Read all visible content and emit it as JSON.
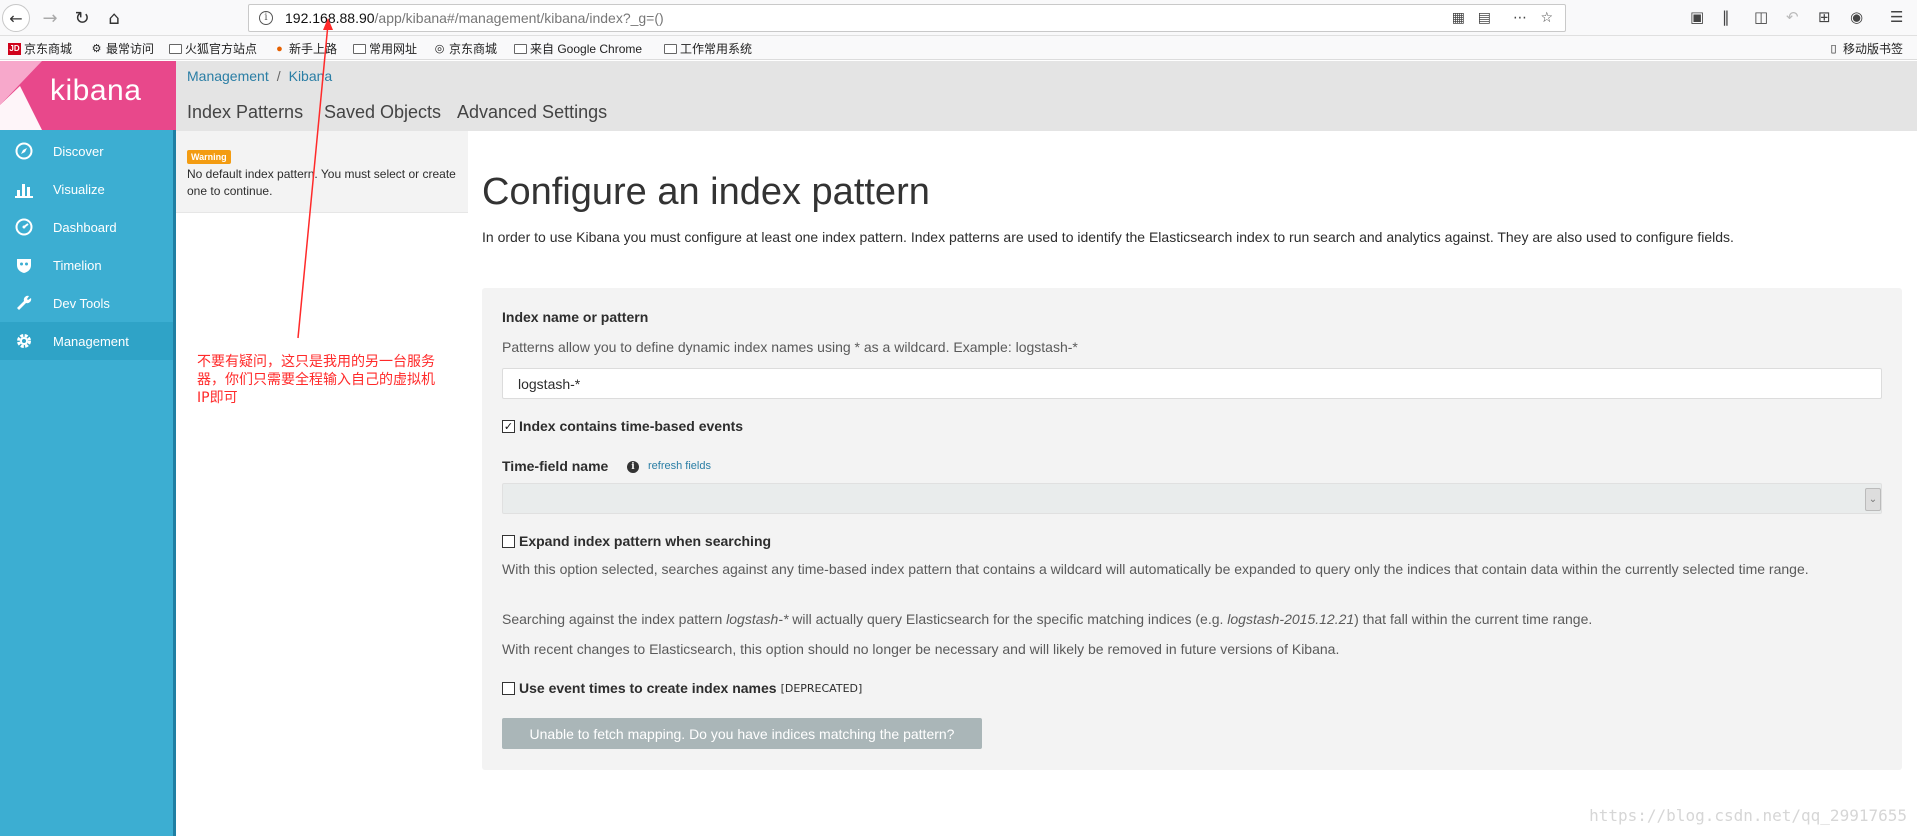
{
  "browser": {
    "url_host": "192.168.88.90",
    "url_path": "/app/kibana#/management/kibana/index?_g=()",
    "bookmarks": [
      "京东商城",
      "最常访问",
      "火狐官方站点",
      "新手上路",
      "常用网址",
      "京东商城",
      "来自 Google Chrome",
      "工作常用系统"
    ],
    "mobile_bookmarks": "移动版书签",
    "jd_badge": "JD"
  },
  "kibana": {
    "logo_text": "kibana",
    "nav": [
      "Discover",
      "Visualize",
      "Dashboard",
      "Timelion",
      "Dev Tools",
      "Management"
    ],
    "active_nav": "Management"
  },
  "header": {
    "breadcrumb": [
      "Management",
      "Kibana"
    ],
    "tabs": [
      "Index Patterns",
      "Saved Objects",
      "Advanced Settings"
    ]
  },
  "index_list": {
    "warning_badge": "Warning",
    "warning_text": "No default index pattern. You must select or create one to continue."
  },
  "main": {
    "title": "Configure an index pattern",
    "intro": "In order to use Kibana you must configure at least one index pattern. Index patterns are used to identify the Elasticsearch index to run search and analytics against. They are also used to configure fields.",
    "index_label": "Index name or pattern",
    "index_help": "Patterns allow you to define dynamic index names using * as a wildcard. Example: logstash-*",
    "index_value": "logstash-*",
    "time_based_label": "Index contains time-based events",
    "time_based_checked": true,
    "time_field_label": "Time-field name",
    "refresh_fields": "refresh fields",
    "expand_label": "Expand index pattern when searching",
    "expand_checked": false,
    "expand_help_1": "With this option selected, searches against any time-based index pattern that contains a wildcard will automatically be expanded to query only the indices that contain data within the currently selected time range.",
    "expand_help_2_pre": "Searching against the index pattern ",
    "expand_help_2_em1": "logstash-*",
    "expand_help_2_mid": " will actually query Elasticsearch for the specific matching indices (e.g. ",
    "expand_help_2_em2": "logstash-2015.12.21",
    "expand_help_2_post": ") that fall within the current time range.",
    "expand_help_3": "With recent changes to Elasticsearch, this option should no longer be necessary and will likely be removed in future versions of Kibana.",
    "event_times_label": "Use event times to create index names",
    "event_times_checked": false,
    "deprecated": "[DEPRECATED]",
    "fetch_button": "Unable to fetch mapping. Do you have indices matching the pattern?"
  },
  "annotation": {
    "text": "不要有疑问，这只是我用的另一台服务器，你们只需要全程输入自己的虚拟机IP即可",
    "color": "#ff2a2a"
  },
  "watermark": "https://blog.csdn.net/qq_29917655",
  "colors": {
    "sidebar": "#3caed2",
    "logo_bg": "#e8488b",
    "warning": "#f39c12",
    "link": "#2a7ea5"
  }
}
